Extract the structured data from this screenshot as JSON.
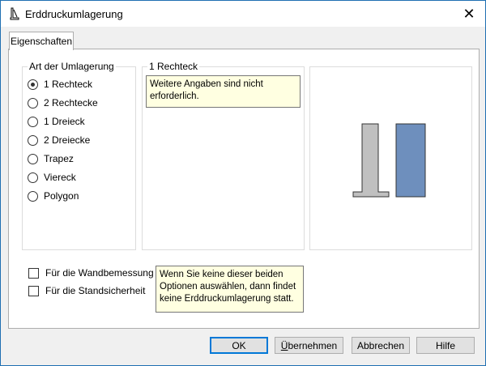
{
  "window": {
    "title": "Erddruckumlagerung",
    "close_glyph": "✕"
  },
  "tab": {
    "label": "Eigenschaften"
  },
  "art_group": {
    "label": "Art der Umlagerung",
    "options": [
      {
        "label": "1 Rechteck",
        "checked": true
      },
      {
        "label": "2 Rechtecke",
        "checked": false
      },
      {
        "label": "1 Dreieck",
        "checked": false
      },
      {
        "label": "2 Dreiecke",
        "checked": false
      },
      {
        "label": "Trapez",
        "checked": false
      },
      {
        "label": "Viereck",
        "checked": false
      },
      {
        "label": "Polygon",
        "checked": false
      }
    ]
  },
  "detail_group": {
    "label": "1 Rechteck",
    "hint": "Weitere Angaben sind nicht erforderlich."
  },
  "preview": {
    "wall_color": "#c0c0c0",
    "pressure_color": "#6e8fbd"
  },
  "options": {
    "wandbemessung": {
      "label": "Für die Wandbemessung",
      "checked": false
    },
    "standsicherheit": {
      "label": "Für die Standsicherheit",
      "checked": false
    },
    "hint": "Wenn Sie keine dieser beiden Optionen auswählen, dann findet keine Erddruckumlagerung statt."
  },
  "buttons": {
    "ok": "OK",
    "apply_first": "Ü",
    "apply_rest": "bernehmen",
    "cancel": "Abbrechen",
    "help": "Hilfe"
  }
}
